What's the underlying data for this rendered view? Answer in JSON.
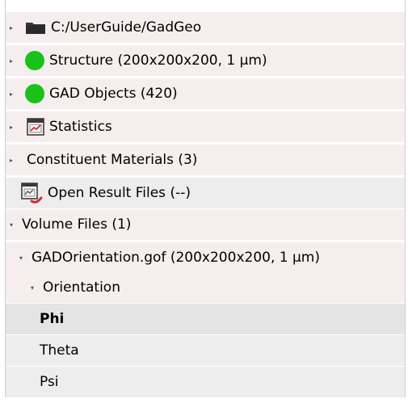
{
  "tree": {
    "items": [
      {
        "label": "C:/UserGuide/GadGeo",
        "icon": "folder-icon",
        "expanded": false
      },
      {
        "label": "Structure (200x200x200, 1 µm)",
        "icon": "green-status-icon",
        "expanded": false
      },
      {
        "label": "GAD Objects (420)",
        "icon": "green-status-icon",
        "expanded": false
      },
      {
        "label": "Statistics",
        "icon": "statistics-icon",
        "expanded": false
      },
      {
        "label": "Constituent Materials (3)",
        "expanded": false
      },
      {
        "label": "Open Result Files (--)",
        "icon": "result-files-icon"
      },
      {
        "label": "Volume Files (1)",
        "expanded": true
      },
      {
        "label": "GADOrientation.gof (200x200x200, 1 µm)",
        "expanded": true
      },
      {
        "label": "Orientation",
        "expanded": true
      },
      {
        "label": "Phi",
        "selected": true
      },
      {
        "label": "Theta"
      },
      {
        "label": "Psi"
      }
    ]
  },
  "colors": {
    "status_green": "#19c119",
    "row_pink": "#f6eeee",
    "row_gray": "#ededed"
  }
}
